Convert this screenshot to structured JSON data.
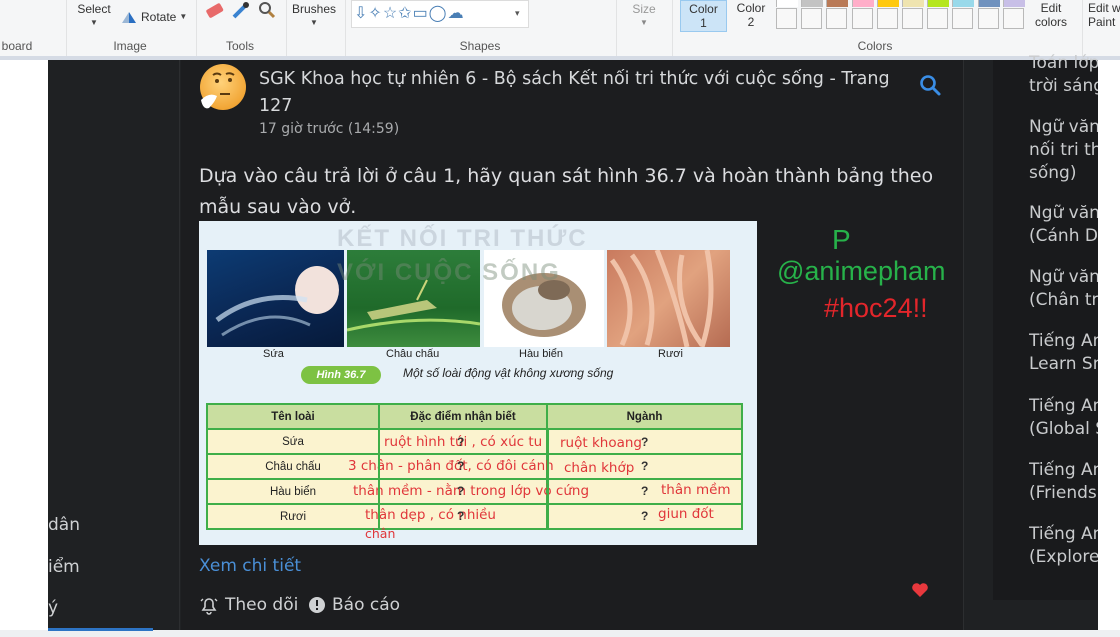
{
  "ribbon": {
    "groups": [
      {
        "label": "board"
      },
      {
        "label": "Image"
      },
      {
        "label": "Tools"
      },
      {
        "label": "Shapes"
      },
      {
        "label": "Colors"
      }
    ],
    "select_label": "Select",
    "rotate_label": "Rotate",
    "brushes_label": "Brushes",
    "size_label": "Size",
    "color1_label": "Color",
    "color1_num": "1",
    "color2_label": "Color",
    "color2_num": "2",
    "edit_colors_line1": "Edit",
    "edit_colors_line2": "colors",
    "edit_paint_line1": "Edit w",
    "edit_paint_line2": "Paint",
    "palette": [
      "#ffffff",
      "#c3c3c3",
      "#b97a57",
      "#ffaec9",
      "#ffc90e",
      "#efe4b0",
      "#b5e61d",
      "#99d9ea",
      "#7092be",
      "#c8bfe7"
    ]
  },
  "left_sidebar": {
    "items": [
      "dân",
      "iểm",
      "ý"
    ]
  },
  "post": {
    "title": "SGK Khoa học tự nhiên 6 - Bộ sách Kết nối tri thức với cuộc sống - Trang 127",
    "time": "17 giờ trước (14:59)",
    "question": " Dựa vào câu trả lời ở câu 1, hãy quan sát hình 36.7 và hoàn thành bảng theo mẫu sau vào vở.",
    "view_details": "Xem chi tiết",
    "follow": "Theo dõi",
    "report": "Báo cáo"
  },
  "figure": {
    "watermark_line1": "KẾT NỐI TRI THỨC",
    "watermark_line2": "VỚI CUỘC SỐNG",
    "captions": [
      "Sứa",
      "Châu chấu",
      "Hàu biển",
      "Rươi"
    ],
    "badge": "Hình 36.7",
    "caption": "Một số loài động vật không xương sống",
    "table": {
      "headers": [
        "Tên loài",
        "Đặc điểm nhận biết",
        "Ngành"
      ],
      "rows": [
        {
          "name": "Sứa",
          "feature": "ruột hình túi , có xúc tu",
          "phylum": "ruột khoang"
        },
        {
          "name": "Châu chấu",
          "feature": "3 chân - phân đốt, có đôi cánh",
          "phylum": "chân khớp"
        },
        {
          "name": "Hàu biển",
          "feature": "thân mềm - nằm trong lớp vỏ cứng",
          "phylum": "thân mềm"
        },
        {
          "name": "Rươi",
          "feature": "thân dẹp , có nhiều",
          "feature_line2": "chân",
          "phylum": "giun đốt"
        }
      ],
      "placeholder": "?"
    }
  },
  "annotation": {
    "letter": "P",
    "handle": "@animepham",
    "tag": "#hoc24!!"
  },
  "right_sidebar": {
    "items": [
      [
        "Toán lớp",
        "trời sáng"
      ],
      [
        "Ngữ văn",
        "nối tri th",
        "sống)"
      ],
      [
        "Ngữ văn",
        "(Cánh D"
      ],
      [
        "Ngữ văn",
        "(Chân tr"
      ],
      [
        "Tiếng An",
        "Learn Sm"
      ],
      [
        "Tiếng An",
        "(Global S"
      ],
      [
        "Tiếng An",
        "(Friends"
      ],
      [
        "Tiếng An",
        "(Explore"
      ]
    ]
  },
  "colors": {
    "accent_link": "#4a8fd6",
    "heart": "#e8383d",
    "handwriting": "#e0363a"
  }
}
